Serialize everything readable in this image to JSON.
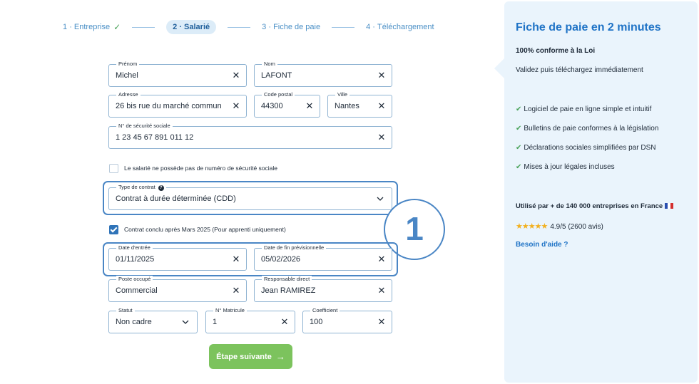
{
  "stepper": {
    "steps": [
      {
        "num": "1",
        "label": "Entreprise",
        "done": true
      },
      {
        "num": "2",
        "label": "Salarié",
        "active": true
      },
      {
        "num": "3",
        "label": "Fiche de paie"
      },
      {
        "num": "4",
        "label": "Téléchargement"
      }
    ],
    "separator": "·"
  },
  "form": {
    "prenom": {
      "label": "Prénom",
      "value": "Michel"
    },
    "nom": {
      "label": "Nom",
      "value": "LAFONT"
    },
    "adresse": {
      "label": "Adresse",
      "value": "26 bis rue du marché commun"
    },
    "code_postal": {
      "label": "Code postal",
      "value": "44300"
    },
    "ville": {
      "label": "Ville",
      "value": "Nantes"
    },
    "secu": {
      "label": "N° de sécurité sociale",
      "value": "1 23 45 67 891 011 12"
    },
    "no_secu_checkbox": {
      "label": "Le salarié ne possède pas de numéro de sécurité sociale",
      "checked": false
    },
    "type_contrat": {
      "label": "Type de contrat",
      "value": "Contrat à durée déterminée (CDD)"
    },
    "apprenti_checkbox": {
      "label": "Contrat conclu après Mars 2025 (Pour apprenti uniquement)",
      "checked": true
    },
    "date_entree": {
      "label": "Date d'entrée",
      "value": "01/11/2025"
    },
    "date_fin": {
      "label": "Date de fin prévisionnelle",
      "value": "05/02/2026"
    },
    "poste": {
      "label": "Poste occupé",
      "value": "Commercial"
    },
    "responsable": {
      "label": "Responsable direct",
      "value": "Jean RAMIREZ"
    },
    "statut": {
      "label": "Statut",
      "value": "Non cadre"
    },
    "matricule": {
      "label": "N° Matricule",
      "value": "1"
    },
    "coefficient": {
      "label": "Coefficient",
      "value": "100"
    },
    "clear_glyph": "✕",
    "help_glyph": "?",
    "next_button": {
      "label": "Étape suivante",
      "arrow": "→"
    }
  },
  "annotation": {
    "badge_number": "1",
    "color": "#4a86c5"
  },
  "panel": {
    "title": "Fiche de paie en 2 minutes",
    "subtitle": "100% conforme à la Loi",
    "text": "Validez puis téléchargez immédiatement",
    "tick": "✔",
    "features": [
      "Logiciel de paie en ligne simple et intuitif",
      "Bulletins de paie conformes à la législation",
      "Déclarations sociales simplifiées par DSN",
      "Mises à jour légales incluses"
    ],
    "users": "Utilisé par + de 140 000 entreprises en France",
    "stars": "★★★★★",
    "rating": "4.9/5 (2600 avis)",
    "help_link": "Besoin d'aide ?"
  },
  "colors": {
    "accent": "#1f73c6",
    "next_button": "#7cc35d",
    "panel_bg": "#eaf4fc",
    "check": "#4aa35a"
  }
}
